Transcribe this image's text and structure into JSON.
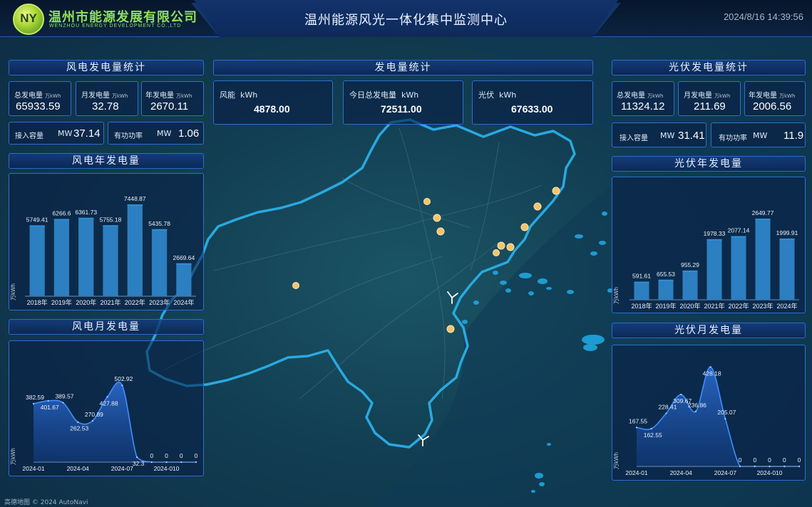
{
  "header": {
    "company_cn": "温州市能源发展有限公司",
    "company_en": "WENZHOU ENERGY DEVELOPMENT CO.,LTD",
    "logo_letters": "NY",
    "title": "温州能源风光一体化集中监测中心",
    "datetime": "2024/8/16 14:39:56"
  },
  "wind_stats": {
    "title": "风电发电量统计",
    "total_label": "总发电量",
    "total_unit": "万kWh",
    "total_value": "65933.59",
    "month_label": "月发电量",
    "month_unit": "万kWh",
    "month_value": "32.78",
    "year_label": "年发电量",
    "year_unit": "万kWh",
    "year_value": "2670.11",
    "capacity_label": "接入容量",
    "capacity_unit": "MW",
    "capacity_value": "37.14",
    "power_label": "有功功率",
    "power_unit": "MW",
    "power_value": "1.06"
  },
  "gen_stats": {
    "title": "发电量统计",
    "wind_label": "风能",
    "wind_unit": "kWh",
    "wind_value": "4878.00",
    "today_label": "今日总发电量",
    "today_unit": "kWh",
    "today_value": "72511.00",
    "pv_label": "光伏",
    "pv_unit": "kWh",
    "pv_value": "67633.00"
  },
  "pv_stats": {
    "title": "光伏发电量统计",
    "total_label": "总发电量",
    "total_unit": "万kWh",
    "total_value": "11324.12",
    "month_label": "月发电量",
    "month_unit": "万kWh",
    "month_value": "211.69",
    "year_label": "年发电量",
    "year_unit": "万kWh",
    "year_value": "2006.56",
    "capacity_label": "接入容量",
    "capacity_unit": "MW",
    "capacity_value": "31.41",
    "power_label": "有功功率",
    "power_unit": "MW",
    "power_value": "11.9"
  },
  "panels": {
    "wind_year_title": "风电年发电量",
    "wind_month_title": "风电月发电量",
    "pv_year_title": "光伏年发电量",
    "pv_month_title": "光伏月发电量"
  },
  "map": {
    "wind_icon": "wind-turbine-icon",
    "pv_icon": "solar-sun-icon",
    "attribution": "高德地图 © 2024 AutoNavi"
  },
  "colors": {
    "bar": "#2c7fc0",
    "bar_top": "#2f8fd6",
    "area_line": "#3f8fff",
    "boundary": "#29a9e0",
    "panel_border": "#2c6fd0"
  },
  "chart_data": [
    {
      "id": "wind_year",
      "type": "bar",
      "ylabel": "万kWh",
      "categories": [
        "2018年",
        "2019年",
        "2020年",
        "2021年",
        "2022年",
        "2023年",
        "2024年"
      ],
      "values": [
        5749.41,
        6266.6,
        6361.73,
        5755.18,
        7448.87,
        5435.78,
        2669.64
      ],
      "ylim": [
        0,
        8200
      ]
    },
    {
      "id": "wind_month",
      "type": "area",
      "ylabel": "万kWh",
      "x": [
        "2024-01",
        "2024-02",
        "2024-03",
        "2024-04",
        "2024-05",
        "2024-06",
        "2024-07",
        "2024-08",
        "2024-09",
        "2024-010",
        "2024-11",
        "2024-12"
      ],
      "x_ticks": [
        "2024-01",
        "2024-04",
        "2024-07",
        "2024-010"
      ],
      "values": [
        382.59,
        401.67,
        389.57,
        262.53,
        270.89,
        427.88,
        502.92,
        32.3,
        0,
        0,
        0,
        0
      ],
      "ylim": [
        0,
        700
      ]
    },
    {
      "id": "pv_year",
      "type": "bar",
      "ylabel": "万kWh",
      "categories": [
        "2018年",
        "2019年",
        "2020年",
        "2021年",
        "2022年",
        "2023年",
        "2024年"
      ],
      "values": [
        591.61,
        655.53,
        955.29,
        1978.33,
        2077.14,
        2649.77,
        1999.91
      ],
      "ylim": [
        0,
        3300
      ]
    },
    {
      "id": "pv_month",
      "type": "area",
      "ylabel": "万kWh",
      "x": [
        "2024-01",
        "2024-02",
        "2024-03",
        "2024-04",
        "2024-05",
        "2024-06",
        "2024-07",
        "2024-08",
        "2024-09",
        "2024-010",
        "2024-11",
        "2024-12"
      ],
      "x_ticks": [
        "2024-01",
        "2024-04",
        "2024-07",
        "2024-010"
      ],
      "values": [
        167.55,
        162.55,
        228.41,
        309.67,
        236.86,
        428.18,
        205.07,
        0,
        0,
        0,
        0,
        0
      ],
      "ylim": [
        0,
        460
      ]
    }
  ]
}
